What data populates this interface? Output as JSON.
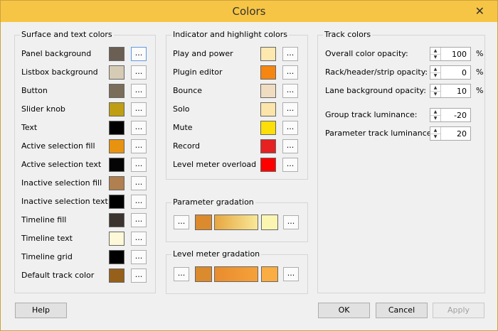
{
  "window": {
    "title": "Colors",
    "close_glyph": "✕"
  },
  "surface": {
    "title": "Surface and text colors",
    "items": [
      {
        "label": "Panel background",
        "color": "#6b5f53"
      },
      {
        "label": "Listbox background",
        "color": "#d6cbb4"
      },
      {
        "label": "Button",
        "color": "#7a6d59"
      },
      {
        "label": "Slider knob",
        "color": "#bf9e14"
      },
      {
        "label": "Text",
        "color": "#000000"
      },
      {
        "label": "Active selection fill",
        "color": "#e8930f"
      },
      {
        "label": "Active selection text",
        "color": "#050505"
      },
      {
        "label": "Inactive selection fill",
        "color": "#b08050"
      },
      {
        "label": "Inactive selection text",
        "color": "#000000"
      },
      {
        "label": "Timeline fill",
        "color": "#3a332e"
      },
      {
        "label": "Timeline text",
        "color": "#fcf8d8"
      },
      {
        "label": "Timeline grid",
        "color": "#000000"
      },
      {
        "label": "Default track color",
        "color": "#96601a"
      }
    ]
  },
  "indicator": {
    "title": "Indicator and highlight colors",
    "items": [
      {
        "label": "Play and power",
        "color": "#fde8b0"
      },
      {
        "label": "Plugin editor",
        "color": "#f58612"
      },
      {
        "label": "Bounce",
        "color": "#f0dcc0"
      },
      {
        "label": "Solo",
        "color": "#fce5ab"
      },
      {
        "label": "Mute",
        "color": "#fcde08"
      },
      {
        "label": "Record",
        "color": "#e52121"
      },
      {
        "label": "Level meter overload",
        "color": "#ff0000"
      }
    ]
  },
  "param_grad": {
    "title": "Parameter gradation",
    "start": "#db8a2e",
    "mid_from": "#e7a740",
    "mid_to": "#f8e898",
    "end": "#faf6b2"
  },
  "level_grad": {
    "title": "Level meter gradation",
    "start": "#db8a2e",
    "mid_from": "#e98c2e",
    "mid_to": "#f5a13a",
    "end": "#f9ad42"
  },
  "track": {
    "title": "Track colors",
    "items": [
      {
        "label": "Overall color opacity:",
        "value": "100",
        "unit": "%"
      },
      {
        "label": "Rack/header/strip opacity:",
        "value": "0",
        "unit": "%"
      },
      {
        "label": "Lane background opacity:",
        "value": "10",
        "unit": "%"
      },
      {
        "label": "Group track luminance:",
        "value": "-20",
        "unit": ""
      },
      {
        "label": "Parameter track luminance:",
        "value": "20",
        "unit": ""
      }
    ]
  },
  "buttons": {
    "help": "Help",
    "ok": "OK",
    "cancel": "Cancel",
    "apply": "Apply",
    "dots": "..."
  },
  "icons": {
    "up": "▲",
    "down": "▼"
  }
}
